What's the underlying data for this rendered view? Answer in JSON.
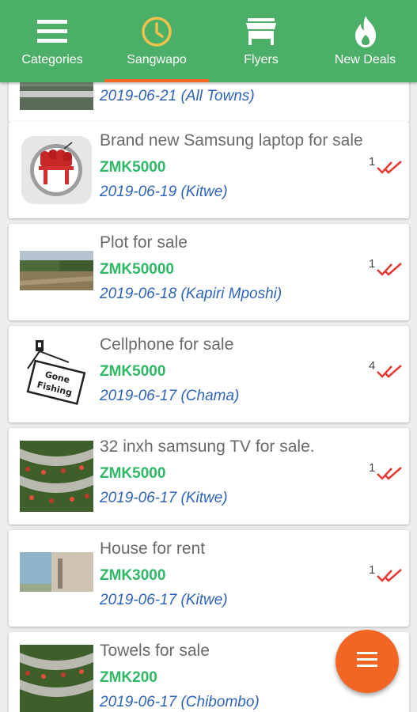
{
  "tabs": [
    {
      "label": "Categories",
      "icon": "menu-icon"
    },
    {
      "label": "Sangwapo",
      "icon": "clock-icon",
      "active": true
    },
    {
      "label": "Flyers",
      "icon": "store-icon"
    },
    {
      "label": "New Deals",
      "icon": "flame-icon"
    }
  ],
  "colors": {
    "primary": "#4caf68",
    "accent": "#f26522",
    "price": "#2fb866",
    "meta": "#2e63b8",
    "tick": "#e53935"
  },
  "listings": [
    {
      "title": "",
      "price": "",
      "meta": "2019-06-21 (All Towns)",
      "count": ""
    },
    {
      "title": "Brand new Samsung laptop for sale",
      "price": "ZMK5000",
      "meta": "2019-06-19 (Kitwe)",
      "count": "1"
    },
    {
      "title": "Plot for sale",
      "price": "ZMK50000",
      "meta": "2019-06-18 (Kapiri Mposhi)",
      "count": "1"
    },
    {
      "title": "Cellphone for sale",
      "price": "ZMK5000",
      "meta": "2019-06-17 (Chama)",
      "count": "4"
    },
    {
      "title": "32 inxh samsung TV for sale.",
      "price": "ZMK5000",
      "meta": "2019-06-17 (Kitwe)",
      "count": "1"
    },
    {
      "title": "House for rent",
      "price": "ZMK3000",
      "meta": "2019-06-17 (Kitwe)",
      "count": "1"
    },
    {
      "title": "Towels for sale",
      "price": "ZMK200",
      "meta": "2019-06-17 (Chibombo)",
      "count": ""
    }
  ],
  "thumb_text": {
    "gone": "Gone",
    "fishing": "Fishing"
  }
}
